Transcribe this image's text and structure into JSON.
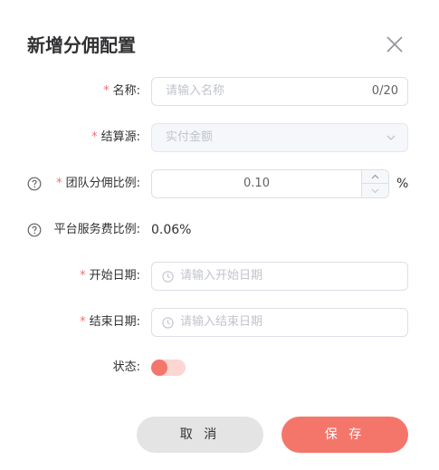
{
  "dialog": {
    "title": "新增分佣配置"
  },
  "form": {
    "name": {
      "required_mark": "*",
      "label": "名称:",
      "placeholder": "请输入名称",
      "counter": "0/20"
    },
    "settlement_source": {
      "required_mark": "*",
      "label": "结算源:",
      "value": "实付金额",
      "disabled": true
    },
    "team_ratio": {
      "required_mark": "*",
      "label": "团队分佣比例:",
      "value": "0.10",
      "unit": "%"
    },
    "platform_fee": {
      "label": "平台服务费比例:",
      "value": "0.06%"
    },
    "start_date": {
      "required_mark": "*",
      "label": "开始日期:",
      "placeholder": "请输入开始日期"
    },
    "end_date": {
      "required_mark": "*",
      "label": "结束日期:",
      "placeholder": "请输入结束日期"
    },
    "status": {
      "label": "状态:",
      "on": false
    }
  },
  "footer": {
    "cancel_label": "取 消",
    "save_label": "保 存"
  },
  "colors": {
    "accent": "#f4766b",
    "required": "#f56c6c",
    "cancel_bg": "#e4e4e4",
    "switch_track": "#fcd6d2"
  },
  "icons": {
    "close": "close-icon",
    "help": "question-circle-icon",
    "arrow": "chevron-down-icon",
    "clock": "clock-icon",
    "step_up": "chevron-up-icon",
    "step_down": "chevron-down-icon"
  }
}
